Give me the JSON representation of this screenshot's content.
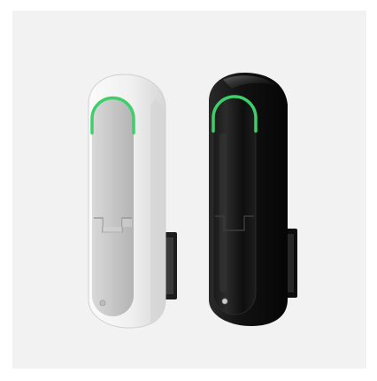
{
  "image": {
    "subject": "two-handle-locks-product-photo",
    "background_color": "#f2f2f2",
    "products": [
      {
        "name": "white-lock",
        "body_color": "#e9e9e9",
        "handle_color": "#c9c9c9",
        "led_color": "#3ecf6a"
      },
      {
        "name": "black-lock",
        "body_color": "#111111",
        "handle_color": "#1c1c1c",
        "led_color": "#3ecf6a"
      }
    ]
  }
}
